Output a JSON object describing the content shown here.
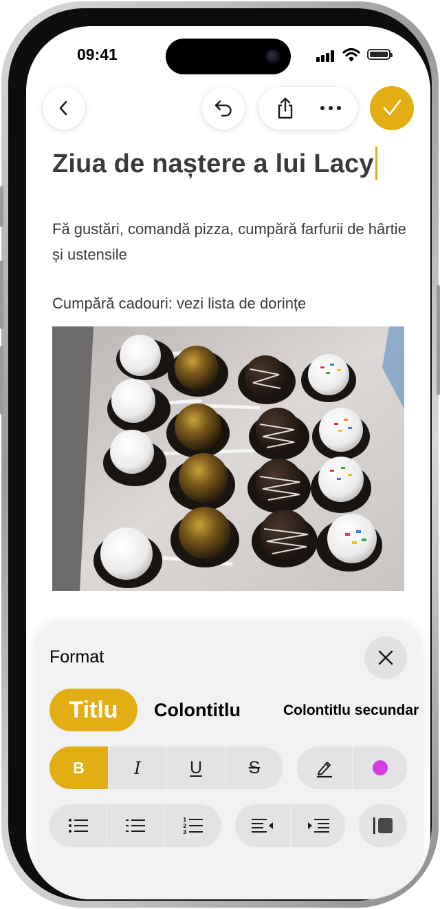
{
  "status_bar": {
    "time": "09:41"
  },
  "toolbar": {
    "back_icon": "chevron-left-icon",
    "undo_icon": "undo-icon",
    "share_icon": "share-icon",
    "more_icon": "ellipsis-icon",
    "done_icon": "checkmark-icon"
  },
  "note": {
    "title": "Ziua de naștere a lui Lacy",
    "paragraph1": "Fă gustări, comandă pizza, cumpără farfurii de hârtie și ustensile",
    "paragraph2": "Cumpără cadouri: vezi lista de dorințe",
    "image_icon": "cake-pops-photo"
  },
  "format_panel": {
    "title": "Format",
    "close_icon": "close-icon",
    "styles": {
      "title": "Titlu",
      "heading": "Colontitlu",
      "subheading": "Colontitlu secundar"
    },
    "text_buttons": {
      "bold": "B",
      "italic": "I",
      "underline": "U",
      "strikethrough": "S"
    },
    "highlight_icon": "pen-icon",
    "color_swatch": "#d63be0",
    "accent_color": "#e3ad14"
  }
}
